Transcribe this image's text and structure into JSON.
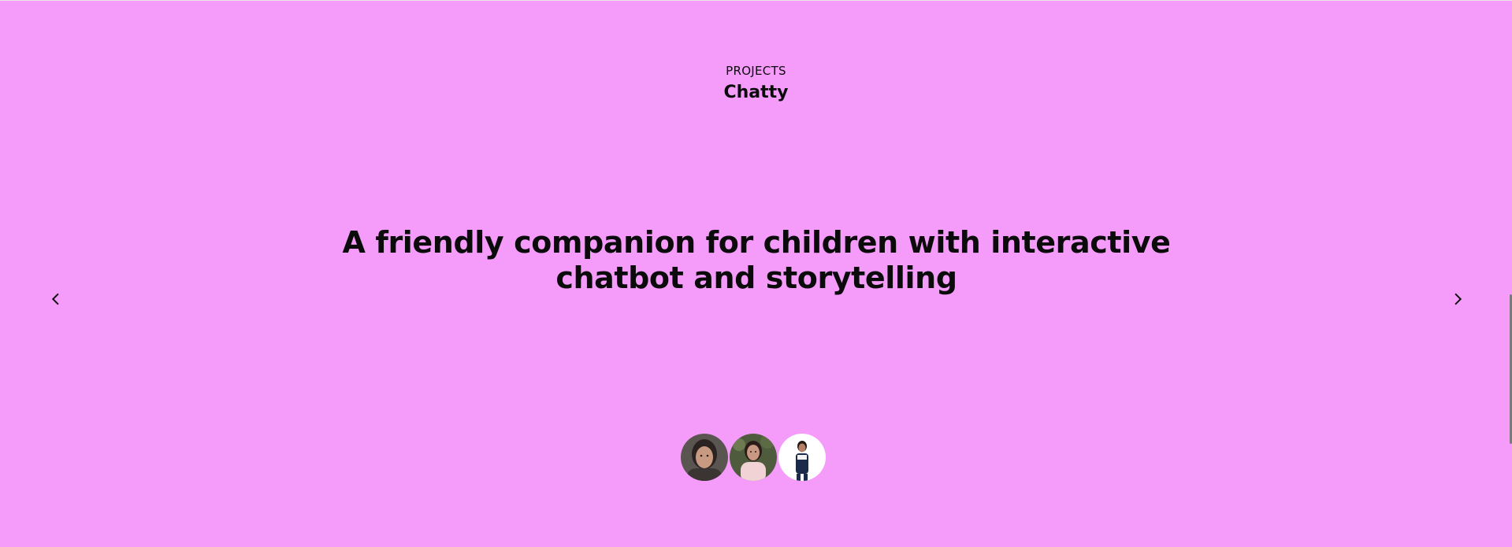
{
  "section": {
    "kicker": "PROJECTS",
    "project_name": "Chatty",
    "headline": "A friendly companion for children with interactive chatbot and storytelling"
  },
  "navigation": {
    "prev_icon": "chevron-left-icon",
    "next_icon": "chevron-right-icon"
  },
  "team": {
    "members": [
      {
        "icon": "avatar-photo-1"
      },
      {
        "icon": "avatar-photo-2"
      },
      {
        "icon": "avatar-photo-3"
      }
    ]
  },
  "theme": {
    "background": "#f59cfb",
    "text": "#0b0b0b"
  }
}
